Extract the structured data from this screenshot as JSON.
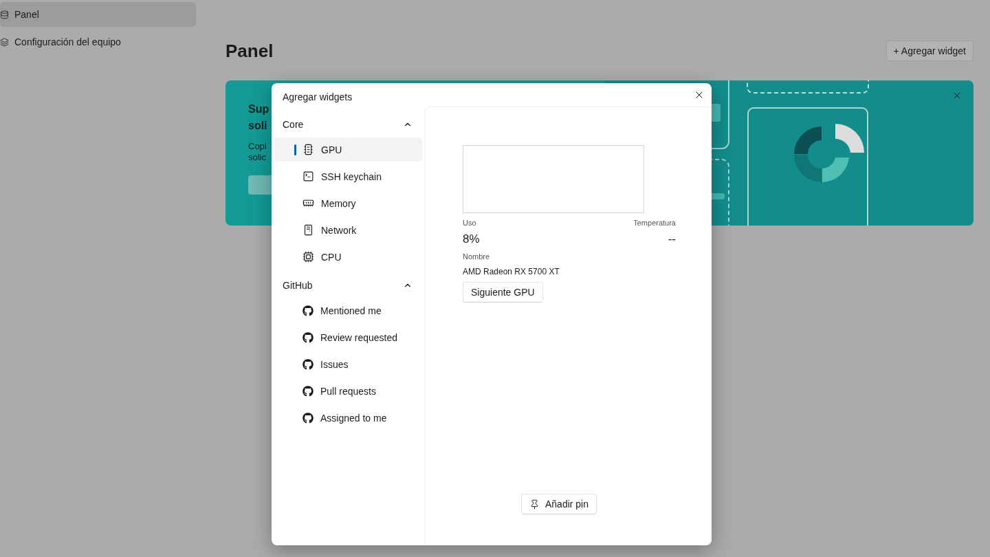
{
  "sidebar": {
    "items": [
      {
        "label": "Panel",
        "kind": "dashboard",
        "selected": true
      },
      {
        "label": "Configuración del equipo",
        "kind": "layers",
        "selected": false
      }
    ]
  },
  "page": {
    "title": "Panel",
    "add_button": "+ Agregar widget"
  },
  "banner": {
    "title_lines": [
      "Sup",
      "soli"
    ],
    "text_lines": [
      "Copi",
      "solic"
    ]
  },
  "dialog": {
    "title": "Agregar widgets",
    "groups": [
      {
        "label": "Core",
        "expanded": true,
        "children": [
          {
            "label": "GPU",
            "kind": "chip",
            "selected": true
          },
          {
            "label": "SSH keychain",
            "kind": "terminal",
            "selected": false
          },
          {
            "label": "Memory",
            "kind": "memory",
            "selected": false
          },
          {
            "label": "Network",
            "kind": "tower",
            "selected": false
          },
          {
            "label": "CPU",
            "kind": "cpu",
            "selected": false
          }
        ]
      },
      {
        "label": "GitHub",
        "expanded": true,
        "children": [
          {
            "label": "Mentioned me",
            "kind": "github",
            "selected": false
          },
          {
            "label": "Review requested",
            "kind": "github",
            "selected": false
          },
          {
            "label": "Issues",
            "kind": "github",
            "selected": false
          },
          {
            "label": "Pull requests",
            "kind": "github",
            "selected": false
          },
          {
            "label": "Assigned to me",
            "kind": "github",
            "selected": false
          }
        ]
      }
    ],
    "widget": {
      "usage_label": "Uso",
      "usage": "8%",
      "temp_label": "Temperatura",
      "temp": "--",
      "name_label": "Nombre",
      "name": "AMD Radeon RX 5700 XT",
      "next_button": "Siguiente GPU"
    },
    "pin_button": "Añadir pin"
  }
}
